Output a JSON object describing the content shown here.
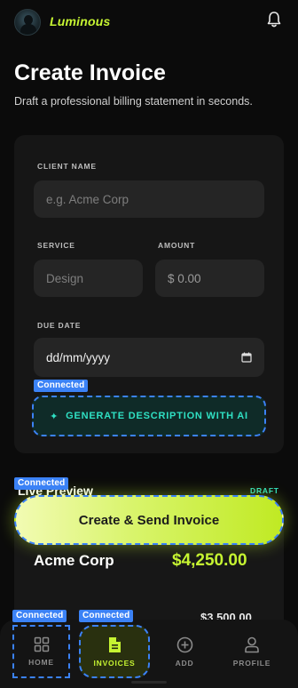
{
  "header": {
    "brand": "Luminous",
    "avatar_icon": "user-avatar",
    "bell_icon": "bell-icon"
  },
  "page": {
    "title": "Create Invoice",
    "subtitle": "Draft a professional billing statement in seconds."
  },
  "form": {
    "client_label": "CLIENT NAME",
    "client_placeholder": "e.g. Acme Corp",
    "service_label": "SERVICE",
    "service_placeholder": "Design",
    "amount_label": "AMOUNT",
    "amount_placeholder": "$ 0.00",
    "due_label": "DUE DATE",
    "due_value": "dd/mm/yyyy",
    "connected_tag": "Connected",
    "generate_label": "GENERATE DESCRIPTION WITH AI"
  },
  "preview": {
    "label": "Live Preview",
    "status": "DRAFT",
    "connected_tag": "Connected",
    "cta_label": "Create & Send Invoice",
    "client": "Acme Corp",
    "total": "$4,250.00",
    "secondary_amount": "$3,500.00"
  },
  "nav": {
    "connected_tag": "Connected",
    "items": [
      {
        "label": "HOME",
        "icon": "grid-icon"
      },
      {
        "label": "INVOICES",
        "icon": "document-icon"
      },
      {
        "label": "ADD",
        "icon": "plus-circle-icon"
      },
      {
        "label": "PROFILE",
        "icon": "person-icon"
      }
    ]
  },
  "colors": {
    "accent_lime": "#c6f432",
    "accent_teal": "#2fe0c3",
    "tag_blue": "#3b82f6",
    "background": "#0b0b0b"
  }
}
